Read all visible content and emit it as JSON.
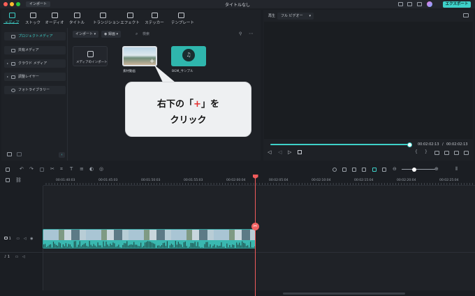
{
  "titlebar": {
    "import_label": "インポート",
    "title": "タイトルなし",
    "export_label": "エクスポート"
  },
  "tabs": [
    {
      "label": "メディア",
      "icon": "media-icon",
      "active": true
    },
    {
      "label": "ストック",
      "icon": "stock-icon"
    },
    {
      "label": "オーディオ",
      "icon": "music-note-icon"
    },
    {
      "label": "タイトル",
      "icon": "text-icon"
    },
    {
      "label": "トランジション",
      "icon": "transition-icon"
    },
    {
      "label": "エフェクト",
      "icon": "effect-sparkle-icon"
    },
    {
      "label": "ステッカー",
      "icon": "sticker-icon"
    },
    {
      "label": "テンプレート",
      "icon": "template-icon"
    }
  ],
  "sidebar": {
    "items": [
      {
        "label": "プロジェクトメディア",
        "active": true
      },
      {
        "label": "共有メディア"
      },
      {
        "label": "クラウド メディア"
      },
      {
        "label": "調整レイヤー"
      },
      {
        "label": "フォトライブラリー"
      }
    ]
  },
  "media_toolbar": {
    "import_dropdown": "インポート",
    "sort_dropdown": "録画",
    "search_placeholder": "検索"
  },
  "media_items": [
    {
      "label": "メディアのインポート",
      "icon": "import-icon"
    },
    {
      "label": "素材動画"
    },
    {
      "label": "BGM_サンプル",
      "icon": "music-note-icon"
    }
  ],
  "tooltip": {
    "line1_pre": "右下の「",
    "line1_plus": "+",
    "line1_post": "」を",
    "line2": "クリック"
  },
  "preview": {
    "label": "再生",
    "quality": "フル ビデオー",
    "current_time": "00:02:02:13",
    "separator": "/",
    "total_time": "00:02:02:13",
    "progress": 1.0
  },
  "timeline": {
    "ruler_ticks": [
      "00:01:40:03",
      "00:01:45:03",
      "00:01:50:03",
      "00:01:55:03",
      "00:02:00:04",
      "00:02:05:04",
      "00:02:10:04",
      "00:02:15:04",
      "00:02:20:04",
      "00:02:25:04"
    ],
    "video_track_label": "1",
    "audio_track_label": "1"
  },
  "colors": {
    "accent": "#3ed1c9",
    "playhead": "#f05b5b",
    "plus_mark": "#e53030"
  }
}
